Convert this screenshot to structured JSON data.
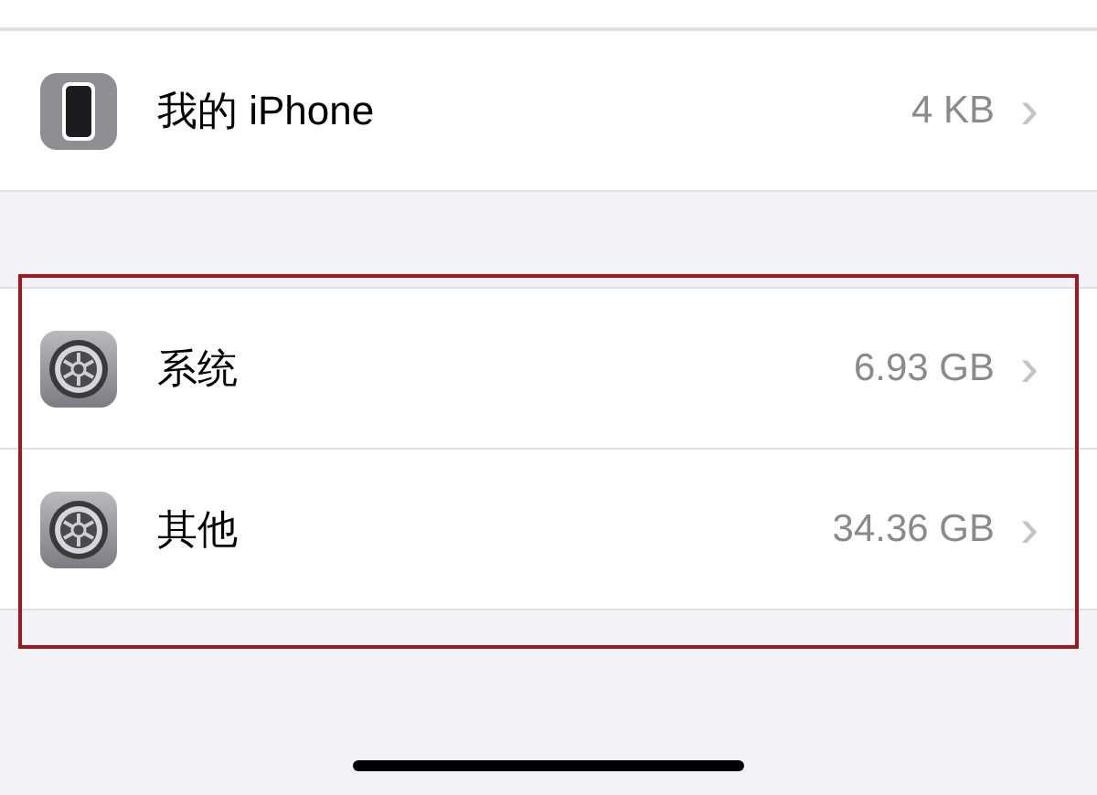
{
  "sections": [
    {
      "highlighted": false,
      "rows": [
        {
          "kind": "device",
          "label": "我的 iPhone",
          "value": "4 KB",
          "chevron": "›"
        }
      ]
    },
    {
      "highlighted": true,
      "rows": [
        {
          "kind": "settings",
          "label": "系统",
          "value": "6.93 GB",
          "chevron": "›"
        },
        {
          "kind": "settings",
          "label": "其他",
          "value": "34.36 GB",
          "chevron": "›"
        }
      ]
    }
  ]
}
